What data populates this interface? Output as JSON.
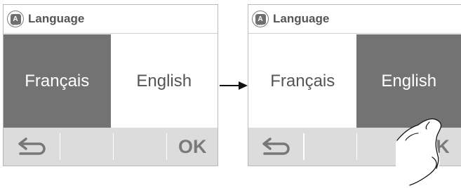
{
  "screen1": {
    "title": "Language",
    "options": [
      {
        "label": "Français",
        "selected": true
      },
      {
        "label": "English",
        "selected": false
      }
    ],
    "ok_label": "OK"
  },
  "screen2": {
    "title": "Language",
    "options": [
      {
        "label": "Français",
        "selected": false
      },
      {
        "label": "English",
        "selected": true
      }
    ],
    "ok_label": "OK"
  },
  "icons": {
    "language": "language-icon",
    "back": "back-arrow-icon",
    "transition": "right-arrow-icon",
    "hand": "tapping-hand-icon"
  },
  "colors": {
    "selected_bg": "#737373",
    "bottom_bar_bg": "#dcdcdc",
    "text": "#555555"
  }
}
